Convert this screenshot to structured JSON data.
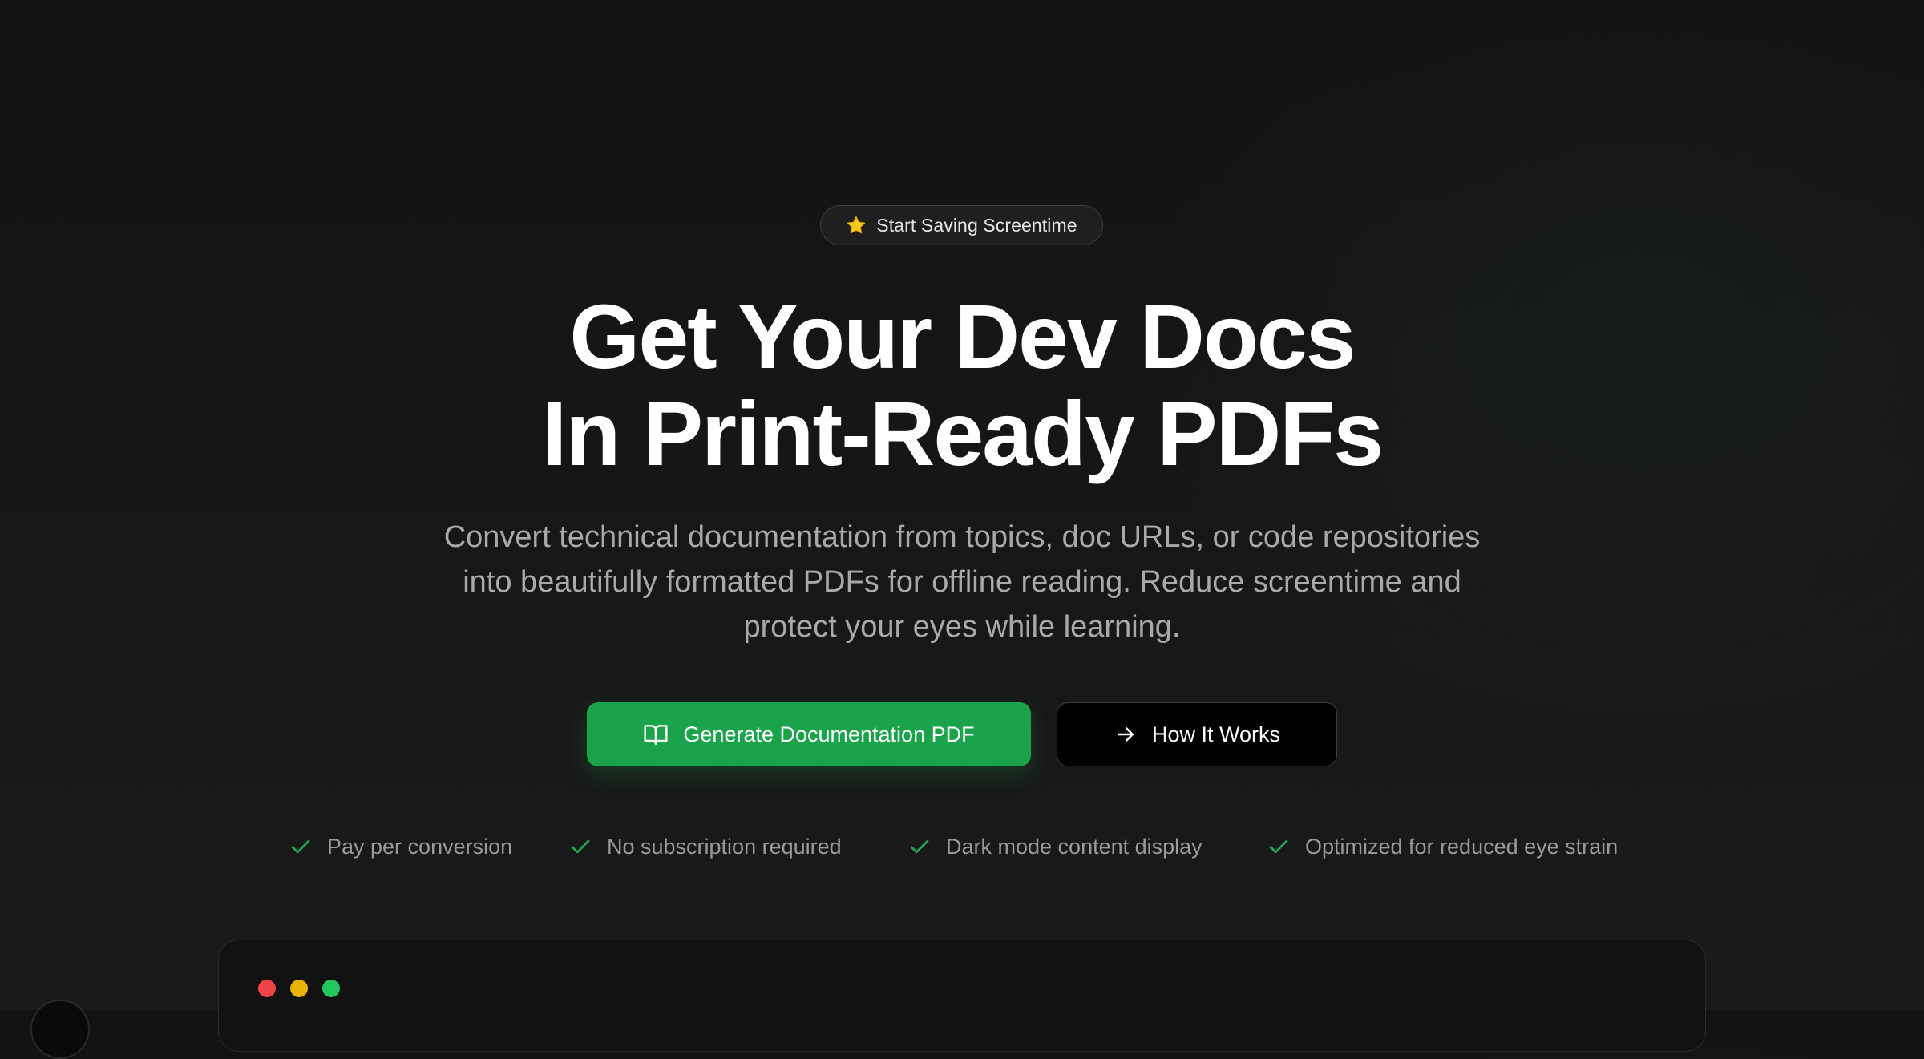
{
  "badge": {
    "icon": "star-icon",
    "label": "Start Saving Screentime"
  },
  "hero": {
    "headline_line1": "Get Your Dev Docs",
    "headline_line2": "In Print-Ready PDFs",
    "description": "Convert technical documentation from topics, doc URLs, or code repositories into beautifully formatted PDFs for offline reading. Reduce screentime and protect your eyes while learning."
  },
  "actions": {
    "primary_label": "Generate Documentation PDF",
    "primary_icon": "book-open-icon",
    "secondary_label": "How It Works",
    "secondary_icon": "arrow-right-icon"
  },
  "features": [
    {
      "icon": "check-icon",
      "label": "Pay per conversion"
    },
    {
      "icon": "check-icon",
      "label": "No subscription required"
    },
    {
      "icon": "check-icon",
      "label": "Dark mode content display"
    },
    {
      "icon": "check-icon",
      "label": "Optimized for reduced eye strain"
    }
  ],
  "colors": {
    "background": "#151515",
    "accent_green": "#1aa34a",
    "check_green": "#22a455",
    "badge_star": "#f5c518",
    "window_dot_red": "#ef4444",
    "window_dot_yellow": "#eab308",
    "window_dot_green": "#22c55e"
  }
}
